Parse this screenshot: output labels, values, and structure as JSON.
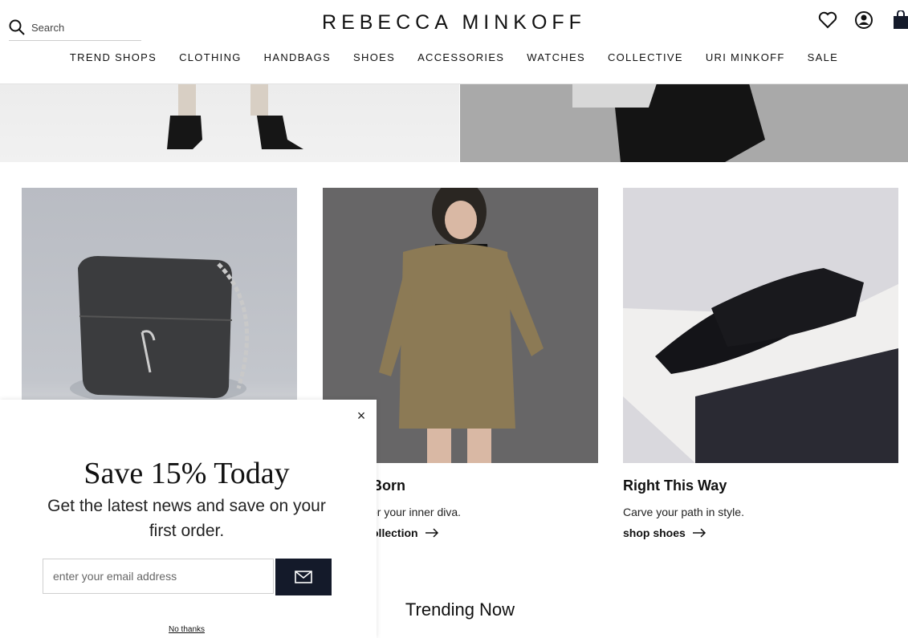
{
  "header": {
    "search_placeholder": "Search",
    "logo": "REBECCA MINKOFF",
    "icons": [
      "search-icon",
      "heart-icon",
      "account-icon",
      "bag-icon"
    ]
  },
  "nav": {
    "items": [
      "TREND SHOPS",
      "CLOTHING",
      "HANDBAGS",
      "SHOES",
      "ACCESSORIES",
      "WATCHES",
      "COLLECTIVE",
      "URI MINKOFF",
      "SALE"
    ]
  },
  "tiles": [
    {
      "title": "",
      "text": "",
      "link": ""
    },
    {
      "title": "s Born",
      "text": "or your inner diva.",
      "link": "ollection"
    },
    {
      "title": "Right This Way",
      "text": "Carve your path in style.",
      "link": "shop shoes"
    }
  ],
  "trending": "Trending Now",
  "modal": {
    "title": "Save 15% Today",
    "subtitle": "Get the latest news and save on your first order.",
    "email_placeholder": "enter your email address",
    "no_thanks": "No thanks",
    "close": "×"
  },
  "colors": {
    "submit_bg": "#141a2a",
    "text": "#111111"
  }
}
